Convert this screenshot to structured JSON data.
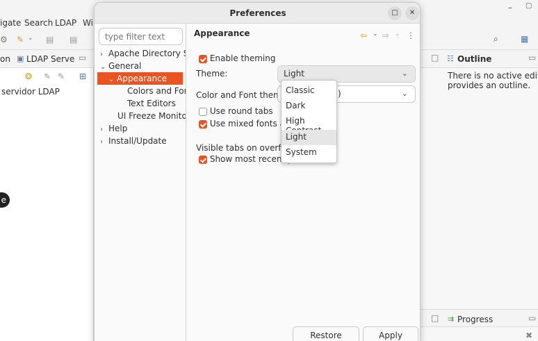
{
  "ide": {
    "menus": [
      "igate",
      "Search",
      "LDAP",
      "Wi"
    ],
    "left_tabs": [
      "on",
      "LDAP Serve"
    ],
    "left_content": "servidor LDAP",
    "left_tooltip": "e",
    "outline_title": "Outline",
    "outline_text_1": "There is no active editor th",
    "outline_text_2": "provides an outline.",
    "progress_title": "Progress"
  },
  "dialog": {
    "title": "Preferences",
    "filter_placeholder": "type filter text",
    "tree": [
      {
        "label": "Apache Directory Stud",
        "arrow": "›"
      },
      {
        "label": "General",
        "arrow": "⌄"
      },
      {
        "label": "Appearance",
        "arrow": "⌄",
        "selected": true
      },
      {
        "label": "Colors and Fonts",
        "arrow": ""
      },
      {
        "label": "Text Editors",
        "arrow": ""
      },
      {
        "label": "UI Freeze Monitorin",
        "arrow": ""
      },
      {
        "label": "Help",
        "arrow": "›"
      },
      {
        "label": "Install/Update",
        "arrow": "›"
      }
    ],
    "page_title": "Appearance",
    "enable_theming": "Enable theming",
    "theme_label": "Theme:",
    "theme_value": "Light",
    "color_font_label": "Color and Font theme:",
    "color_font_value": "Classic",
    "color_font_tail": ")",
    "round_tabs": "Use round tabs",
    "mixed_fonts": "Use mixed fonts and c",
    "visible_tabs_label": "Visible tabs on overflow:",
    "show_recent": "Show most recently us",
    "theme_options": [
      "Classic",
      "Dark",
      "High Contrast",
      "Light",
      "System"
    ],
    "restore_defaults": "Restore Defaults",
    "apply": "Apply"
  },
  "colors": {
    "accent": "#e95420"
  }
}
